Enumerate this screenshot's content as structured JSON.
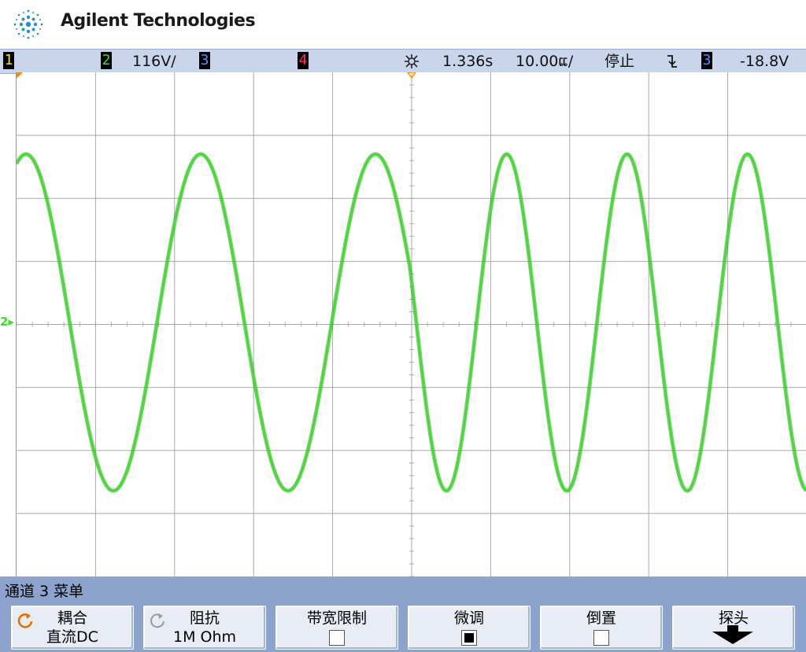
{
  "brand": {
    "name": "Agilent Technologies"
  },
  "colors": {
    "ch1": "#f5e600",
    "ch2": "#3ee12a",
    "ch3": "#5a8cff",
    "ch4": "#ff2f6f",
    "trigger_marker": "#ff8a00",
    "grid": "#a9a9a9",
    "statusbar_bg": "#c9d5ea",
    "menu_bg": "#8ba3cd"
  },
  "status": {
    "ch1_label": "1",
    "ch2_label": "2",
    "ch2_scale": "116V/",
    "ch3_label": "3",
    "ch4_label": "4",
    "delay_icon": "trigger-delay-icon",
    "delay": "1.336s",
    "timebase": "10.00ແ/",
    "run_state": "停止",
    "trigger_slope_icon": "falling-edge-icon",
    "trigger_source": "3",
    "trigger_level": "-18.8V"
  },
  "screen": {
    "ground_marker_label": "2"
  },
  "menu": {
    "title": "通道 3 菜单",
    "softkeys": [
      {
        "top": "耦合",
        "bottom": "直流DC",
        "icon": "rotate-knob-icon"
      },
      {
        "top": "阻抗",
        "bottom": "1M Ohm",
        "icon": "rotate-knob-icon"
      },
      {
        "top": "带宽限制",
        "checkbox": false
      },
      {
        "top": "微调",
        "checkbox": true
      },
      {
        "top": "倒置",
        "checkbox": false
      },
      {
        "top": "探头",
        "icon": "down-arrow-icon"
      }
    ]
  }
}
